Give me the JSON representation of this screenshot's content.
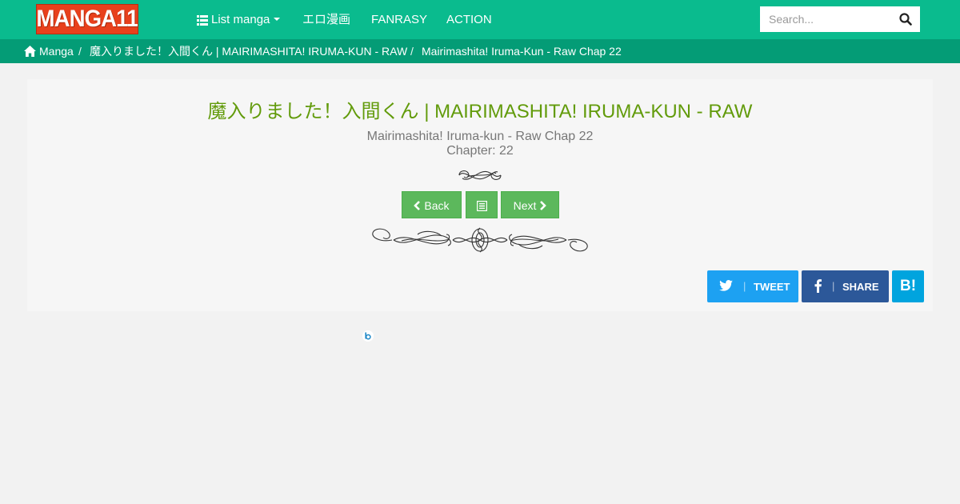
{
  "navbar": {
    "logo_text": "MANGA11",
    "items": [
      {
        "label": "List manga",
        "icon": "list-icon",
        "dropdown": true
      },
      {
        "label": "エロ漫画"
      },
      {
        "label": "FANRASY"
      },
      {
        "label": "ACTION"
      }
    ],
    "search": {
      "placeholder": "Search...",
      "icon": "search-icon"
    }
  },
  "breadcrumb": {
    "home_icon": "home-icon",
    "items": [
      "Manga",
      "魔入りました！入間くん | MAIRIMASHITA! IRUMA-KUN - RAW",
      "Mairimashita! Iruma-Kun - Raw Chap 22"
    ],
    "separator": "/"
  },
  "chapter": {
    "manga_title": "魔入りました！入間くん | MAIRIMASHITA! IRUMA-KUN - RAW",
    "chapter_name": "Mairimashita! Iruma-kun - Raw Chap 22",
    "chapter_number": "Chapter: 22"
  },
  "navigation": {
    "back_label": "Back",
    "back_icon": "chevron-left-icon",
    "list_icon": "chapter-list-icon",
    "next_label": "Next",
    "next_icon": "chevron-right-icon"
  },
  "social": {
    "tweet": {
      "label": "TWEET",
      "icon": "twitter-icon",
      "color": "#1da1f2"
    },
    "share": {
      "label": "SHARE",
      "icon": "facebook-icon",
      "color": "#2c5899"
    },
    "hatena": {
      "label": "B!",
      "icon": "hatena-bookmark-icon",
      "color": "#00a4de"
    }
  },
  "colors": {
    "navbar": "#0abb8e",
    "breadcrumb": "#049c76",
    "title": "#629b0b",
    "button": "#5cb85c",
    "logo": "#e8401c"
  }
}
